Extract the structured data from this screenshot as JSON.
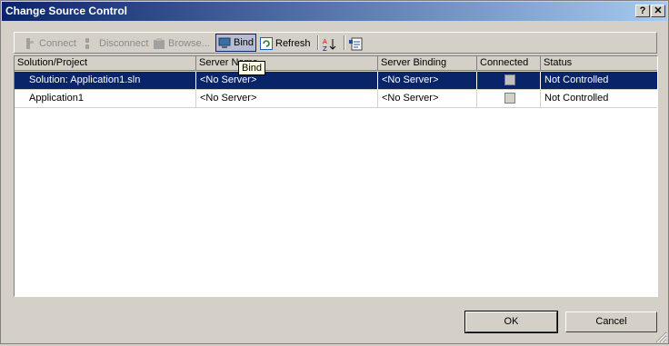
{
  "window": {
    "title": "Change Source Control",
    "help_label": "?",
    "close_label": "✕"
  },
  "toolbar": {
    "connect_label": "Connect",
    "disconnect_label": "Disconnect",
    "browse_label": "Browse...",
    "bind_label": "Bind",
    "refresh_label": "Refresh",
    "icons": [
      "connect-icon",
      "disconnect-icon",
      "browse-icon",
      "bind-icon",
      "refresh-icon",
      "sort-az-icon",
      "properties-icon"
    ]
  },
  "tooltip": {
    "text": "Bind"
  },
  "grid": {
    "columns": [
      "Solution/Project",
      "Server Name",
      "Server Binding",
      "Connected",
      "Status"
    ],
    "rows": [
      {
        "project": "Solution: Application1.sln",
        "server_name": "<No Server>",
        "server_binding": "<No Server>",
        "connected": false,
        "status": "Not Controlled",
        "selected": true
      },
      {
        "project": "Application1",
        "server_name": "<No Server>",
        "server_binding": "<No Server>",
        "connected": false,
        "status": "Not Controlled",
        "selected": false
      }
    ]
  },
  "buttons": {
    "ok_label": "OK",
    "cancel_label": "Cancel"
  },
  "colors": {
    "titlebar": "#0a246a",
    "selection": "#0a246a",
    "face": "#d4d0c8"
  }
}
